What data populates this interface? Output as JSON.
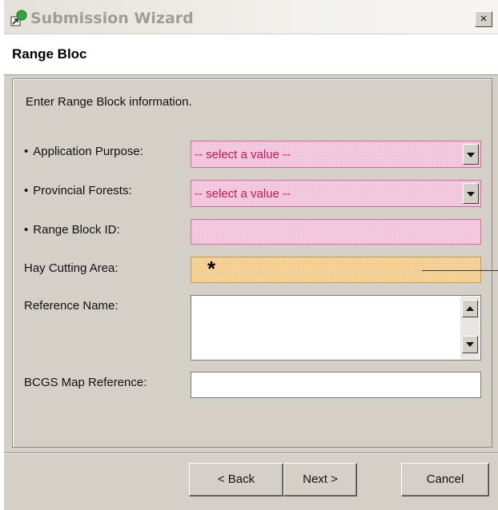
{
  "window": {
    "title": "Submission Wizard",
    "close_label": "×"
  },
  "header": {
    "title": "Range Bloc"
  },
  "instructions": "Enter Range Block information.",
  "fields": {
    "application_purpose": {
      "label": "Application Purpose:",
      "value": "-- select a value --",
      "required": true
    },
    "provincial_forests": {
      "label": "Provincial Forests:",
      "value": "-- select a value --",
      "required": true
    },
    "range_block_id": {
      "label": "Range Block ID:",
      "value": "",
      "required": true
    },
    "hay_cutting_area": {
      "label": "Hay Cutting Area:",
      "value": "*",
      "required": false
    },
    "reference_name": {
      "label": "Reference Name:",
      "value": "",
      "required": false
    },
    "bcgs_map_reference": {
      "label": "BCGS Map Reference:",
      "value": "",
      "required": false
    }
  },
  "buttons": {
    "back": "< Back",
    "next": "Next >",
    "cancel": "Cancel"
  },
  "colors": {
    "required_field": "#f7d3e6",
    "highlighted_field": "#f7d9a8",
    "dialog_bg": "#d4d0c8",
    "select_text": "#c2185b"
  },
  "icons": {
    "app": "wizard-app-icon",
    "dropdown": "chevron-down-icon",
    "scroll_up": "scroll-up-arrow-icon",
    "scroll_down": "scroll-down-arrow-icon"
  }
}
